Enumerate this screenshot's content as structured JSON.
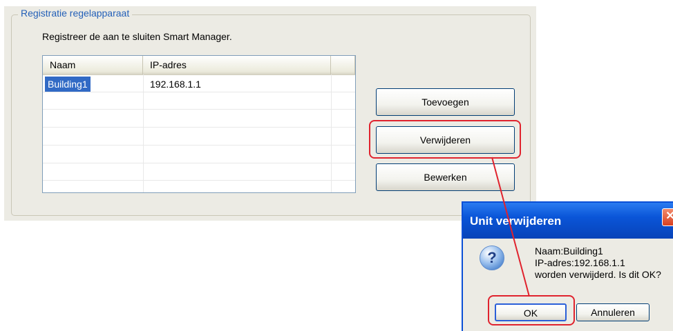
{
  "group": {
    "title": "Registratie regelapparaat",
    "instruction": "Registreer de aan te sluiten Smart Manager."
  },
  "list": {
    "columns": [
      "Naam",
      "IP-adres"
    ],
    "rows": [
      {
        "naam": "Building1",
        "ip": "192.168.1.1"
      }
    ]
  },
  "buttons": {
    "add": "Toevoegen",
    "remove": "Verwijderen",
    "edit": "Bewerken"
  },
  "dialog": {
    "title": "Unit verwijderen",
    "close_glyph": "✕",
    "icon_glyph": "?",
    "line1": "Naam:Building1",
    "line2": "IP-adres:192.168.1.1",
    "line3": "worden verwijderd. Is dit OK?",
    "ok": "OK",
    "cancel": "Annuleren"
  },
  "colors": {
    "highlight": "#e0222d",
    "legend": "#2460b8",
    "selection": "#316ac5"
  }
}
